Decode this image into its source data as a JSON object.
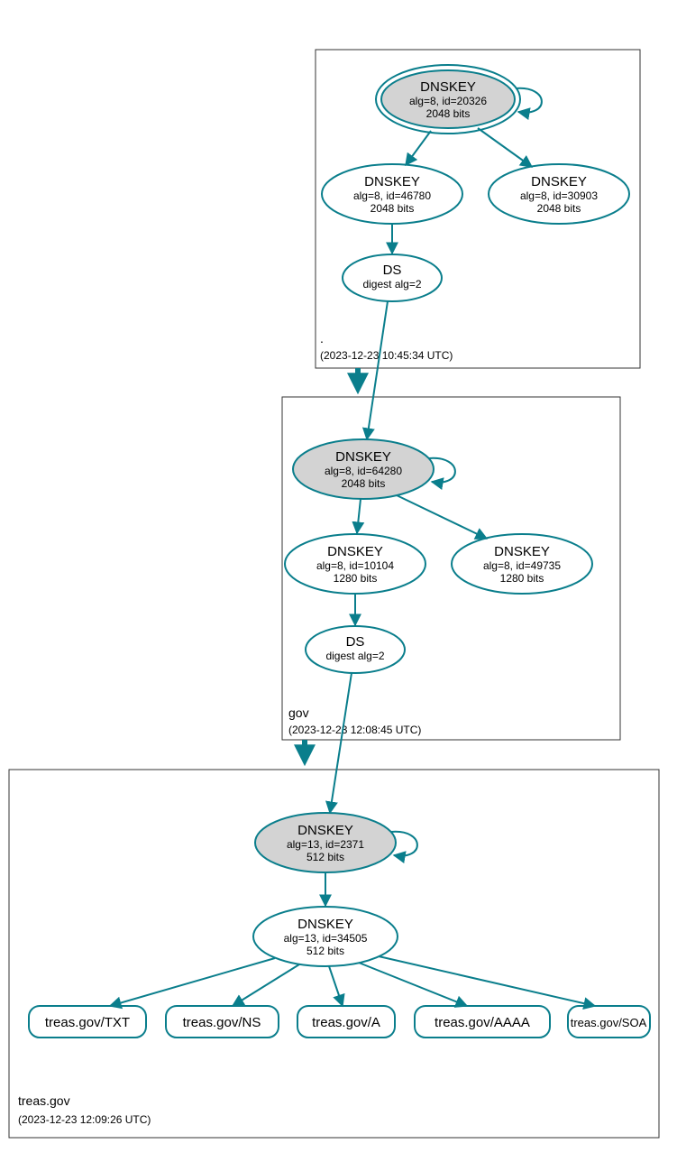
{
  "zones": {
    "root": {
      "labelDot": ".",
      "timestamp": "(2023-12-23 10:45:34 UTC)"
    },
    "gov": {
      "label": "gov",
      "timestamp": "(2023-12-23 12:08:45 UTC)"
    },
    "treas": {
      "label": "treas.gov",
      "timestamp": "(2023-12-23 12:09:26 UTC)"
    }
  },
  "nodes": {
    "root_ksk": {
      "title": "DNSKEY",
      "line2": "alg=8, id=20326",
      "line3": "2048 bits"
    },
    "root_zsk1": {
      "title": "DNSKEY",
      "line2": "alg=8, id=46780",
      "line3": "2048 bits"
    },
    "root_zsk2": {
      "title": "DNSKEY",
      "line2": "alg=8, id=30903",
      "line3": "2048 bits"
    },
    "root_ds": {
      "title": "DS",
      "line2": "digest alg=2"
    },
    "gov_ksk": {
      "title": "DNSKEY",
      "line2": "alg=8, id=64280",
      "line3": "2048 bits"
    },
    "gov_zsk1": {
      "title": "DNSKEY",
      "line2": "alg=8, id=10104",
      "line3": "1280 bits"
    },
    "gov_zsk2": {
      "title": "DNSKEY",
      "line2": "alg=8, id=49735",
      "line3": "1280 bits"
    },
    "gov_ds": {
      "title": "DS",
      "line2": "digest alg=2"
    },
    "treas_ksk": {
      "title": "DNSKEY",
      "line2": "alg=13, id=2371",
      "line3": "512 bits"
    },
    "treas_zsk": {
      "title": "DNSKEY",
      "line2": "alg=13, id=34505",
      "line3": "512 bits"
    },
    "rr_txt": {
      "label": "treas.gov/TXT"
    },
    "rr_ns": {
      "label": "treas.gov/NS"
    },
    "rr_a": {
      "label": "treas.gov/A"
    },
    "rr_aaaa": {
      "label": "treas.gov/AAAA"
    },
    "rr_soa": {
      "label": "treas.gov/SOA"
    }
  }
}
